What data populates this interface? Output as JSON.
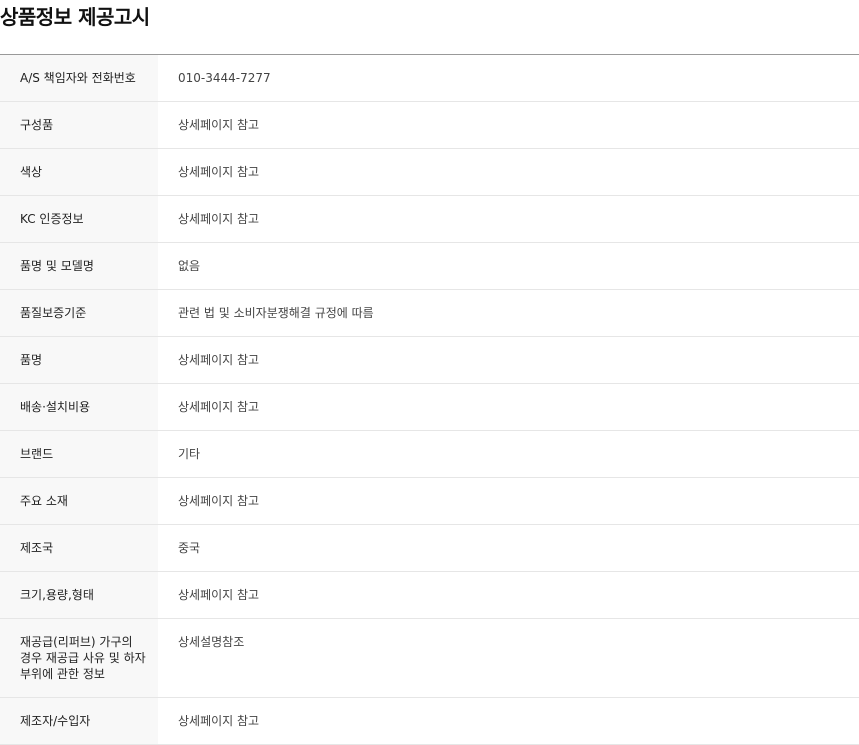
{
  "page": {
    "title": "상품정보 제공고시"
  },
  "rows": [
    {
      "label": "A/S 책임자와 전화번호",
      "value": "010-3444-7277"
    },
    {
      "label": "구성품",
      "value": "상세페이지 참고"
    },
    {
      "label": "색상",
      "value": "상세페이지 참고"
    },
    {
      "label": "KC 인증정보",
      "value": "상세페이지 참고"
    },
    {
      "label": "품명 및 모델명",
      "value": "없음"
    },
    {
      "label": "품질보증기준",
      "value": "관련 법 및 소비자분쟁해결 규정에 따름"
    },
    {
      "label": "품명",
      "value": "상세페이지 참고"
    },
    {
      "label": "배송·설치비용",
      "value": "상세페이지 참고"
    },
    {
      "label": "브랜드",
      "value": "기타"
    },
    {
      "label": "주요 소재",
      "value": "상세페이지 참고"
    },
    {
      "label": "제조국",
      "value": "중국"
    },
    {
      "label": "크기,용량,형태",
      "value": "상세페이지 참고"
    },
    {
      "label": "재공급(리퍼브) 가구의 경우 재공급 사유 및 하자 부위에 관한 정보",
      "value": "상세설명참조"
    },
    {
      "label": "제조자/수입자",
      "value": "상세페이지 참고"
    }
  ]
}
